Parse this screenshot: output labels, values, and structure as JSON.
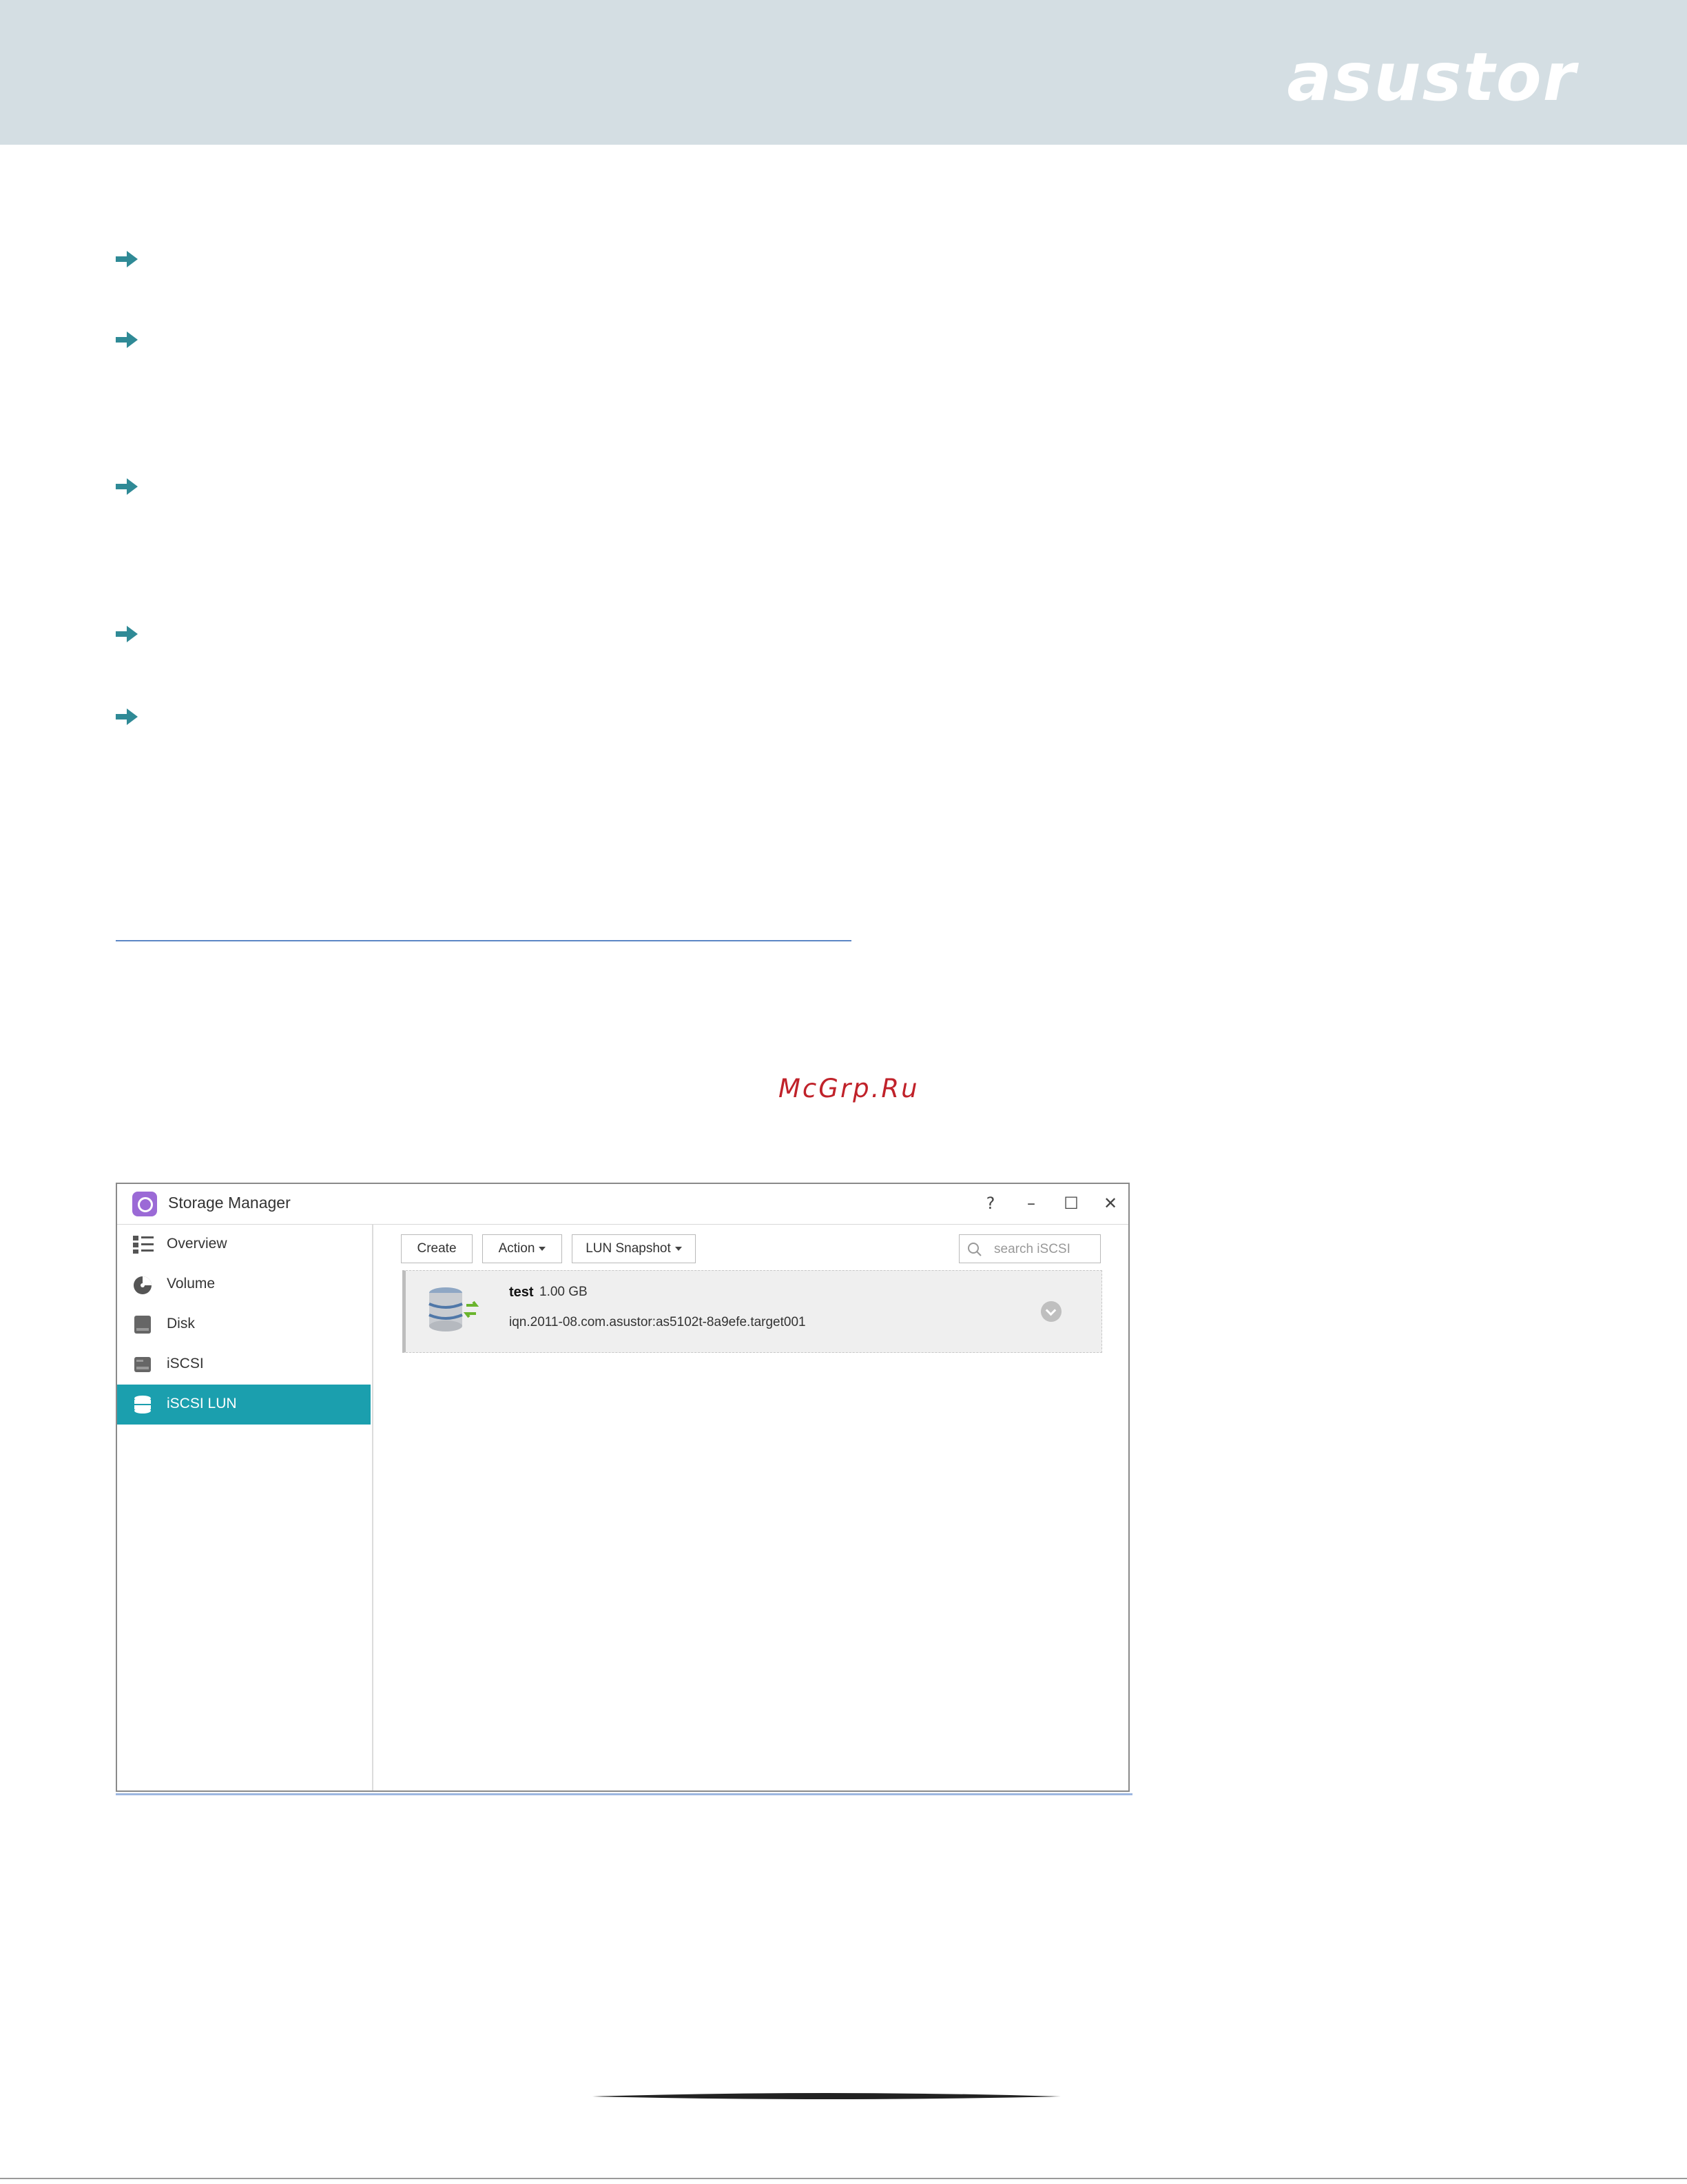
{
  "header": {
    "brand": "asustor",
    "band_color": "#d4dee3"
  },
  "watermark": "McGrp.Ru",
  "bullets": [
    "arrow-right-icon",
    "arrow-right-icon",
    "arrow-right-icon",
    "arrow-right-icon",
    "arrow-right-icon"
  ],
  "accent_color": "#1b9fae",
  "window": {
    "title": "Storage Manager",
    "controls": {
      "help": "?",
      "minimize": "–",
      "maximize": "☐",
      "close": "✕"
    },
    "sidebar": {
      "items": [
        {
          "label": "Overview",
          "icon": "overview-icon",
          "active": false
        },
        {
          "label": "Volume",
          "icon": "volume-icon",
          "active": false
        },
        {
          "label": "Disk",
          "icon": "disk-icon",
          "active": false
        },
        {
          "label": "iSCSI",
          "icon": "iscsi-icon",
          "active": false
        },
        {
          "label": "iSCSI LUN",
          "icon": "iscsi-lun-icon",
          "active": true
        }
      ]
    },
    "toolbar": {
      "create_label": "Create",
      "action_label": "Action",
      "snapshot_label": "LUN Snapshot",
      "search_placeholder": "search iSCSI"
    },
    "luns": [
      {
        "name": "test",
        "size": "1.00 GB",
        "iqn": "iqn.2011-08.com.asustor:as5102t-8a9efe.target001"
      }
    ]
  }
}
